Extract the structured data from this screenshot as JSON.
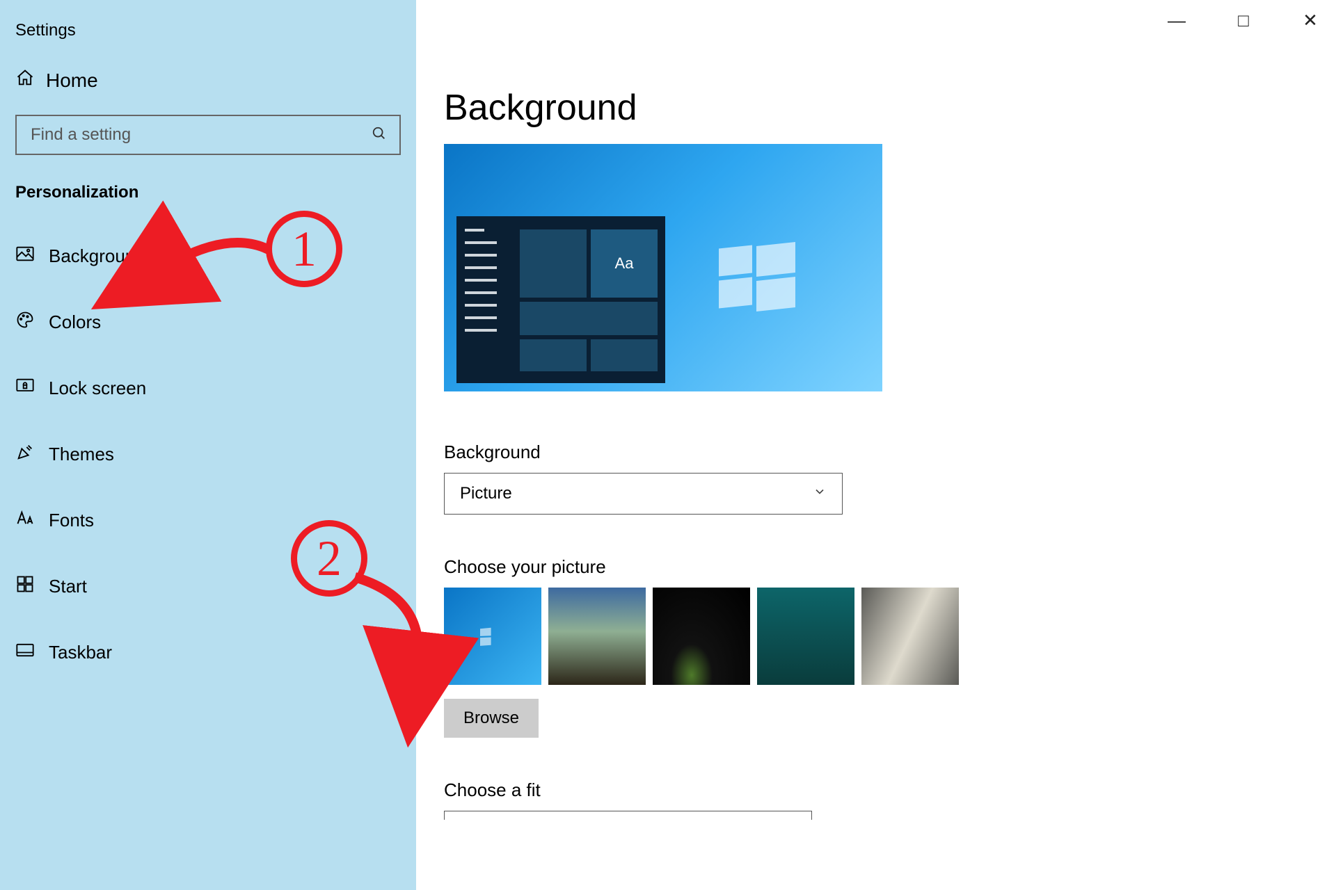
{
  "app_title": "Settings",
  "window_controls": {
    "min": "—",
    "max": "□",
    "close": "✕"
  },
  "home_label": "Home",
  "search_placeholder": "Find a setting",
  "section_label": "Personalization",
  "nav": {
    "background": "Background",
    "colors": "Colors",
    "lockscreen": "Lock screen",
    "themes": "Themes",
    "fonts": "Fonts",
    "start": "Start",
    "taskbar": "Taskbar"
  },
  "page": {
    "title": "Background",
    "preview_sample_text": "Aa",
    "bg_heading": "Background",
    "bg_dropdown_value": "Picture",
    "choose_heading": "Choose your picture",
    "browse_label": "Browse",
    "fit_heading": "Choose a fit"
  },
  "annotations": {
    "step1": "1",
    "step2": "2"
  }
}
